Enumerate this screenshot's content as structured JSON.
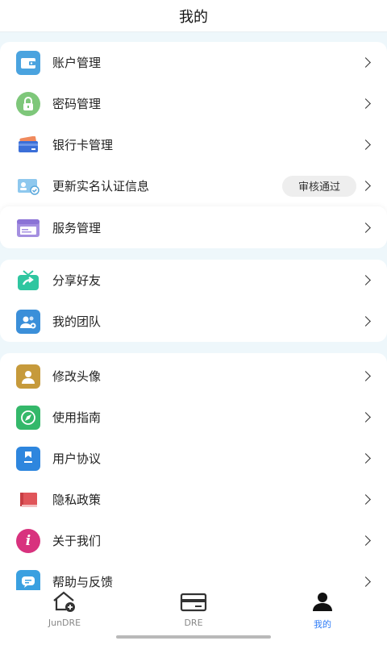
{
  "header": {
    "title": "我的"
  },
  "group1": {
    "items": [
      {
        "label": "账户管理",
        "icon": "wallet-icon"
      },
      {
        "label": "密码管理",
        "icon": "lock-icon"
      },
      {
        "label": "银行卡管理",
        "icon": "bank-card-icon"
      },
      {
        "label": "更新实名认证信息",
        "icon": "id-card-icon",
        "badge": "审核通过"
      }
    ]
  },
  "service": {
    "label": "服务管理",
    "icon": "service-window-icon"
  },
  "group2": {
    "items": [
      {
        "label": "分享好友",
        "icon": "gift-share-icon"
      },
      {
        "label": "我的团队",
        "icon": "team-icon"
      }
    ]
  },
  "group3": {
    "items": [
      {
        "label": "修改头像",
        "icon": "avatar-icon"
      },
      {
        "label": "使用指南",
        "icon": "compass-icon"
      },
      {
        "label": "用户协议",
        "icon": "bookmark-document-icon"
      },
      {
        "label": "隐私政策",
        "icon": "book-icon"
      },
      {
        "label": "关于我们",
        "icon": "info-icon"
      },
      {
        "label": "帮助与反馈",
        "icon": "chat-icon"
      }
    ]
  },
  "tabbar": {
    "tabs": [
      {
        "label": "JunDRE",
        "icon": "home-plus-icon",
        "active": false
      },
      {
        "label": "DRE",
        "icon": "card-icon",
        "active": false
      },
      {
        "label": "我的",
        "icon": "user-icon",
        "active": true
      }
    ]
  },
  "colors": {
    "page_bg": "#eef7fb",
    "active_tab": "#2f7cf6",
    "badge_bg": "#eeeeee"
  }
}
